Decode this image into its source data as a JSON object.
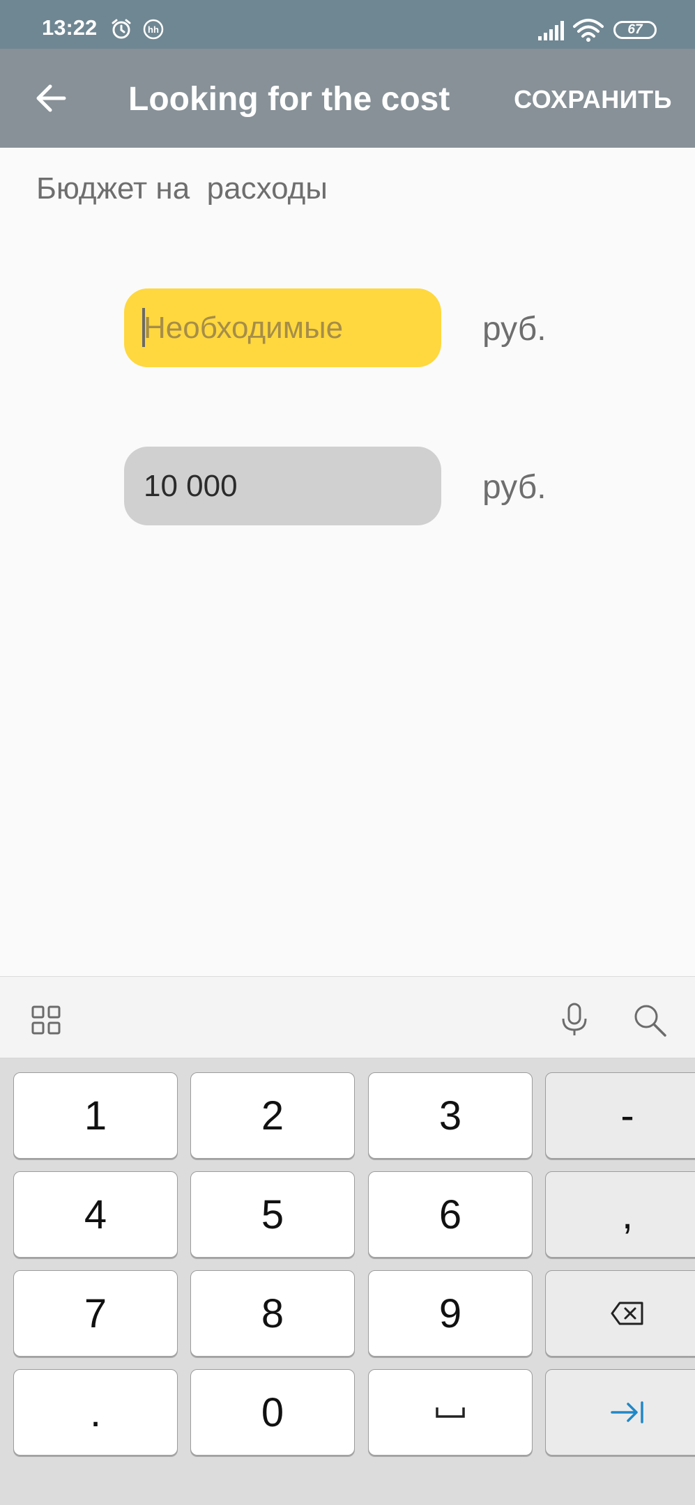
{
  "status_bar": {
    "time": "13:22",
    "battery": "67",
    "icons": [
      "alarm-icon",
      "hh-app-icon",
      "signal-icon",
      "wifi-icon",
      "battery-icon"
    ]
  },
  "app_bar": {
    "back_icon": "arrow-left-icon",
    "title": "Looking for the cost",
    "save_label": "СОХРАНИТЬ"
  },
  "content": {
    "section_label": "Бюджет на  расходы",
    "fields": [
      {
        "placeholder": "Необходимые",
        "value": "",
        "unit": "руб.",
        "focused": true,
        "color": "#fed83e"
      },
      {
        "placeholder": "",
        "value": "10 000",
        "unit": "руб.",
        "focused": false,
        "color": "#d0d0d0"
      }
    ]
  },
  "keyboard": {
    "toolbar_icons": [
      "grid-icon",
      "microphone-icon",
      "search-icon"
    ],
    "rows": [
      [
        "1",
        "2",
        "3",
        "-"
      ],
      [
        "4",
        "5",
        "6",
        ","
      ],
      [
        "7",
        "8",
        "9",
        "backspace-icon"
      ],
      [
        ".",
        "0",
        "space-icon",
        "tab-next-icon"
      ]
    ],
    "accent_color": "#1e88c8"
  }
}
